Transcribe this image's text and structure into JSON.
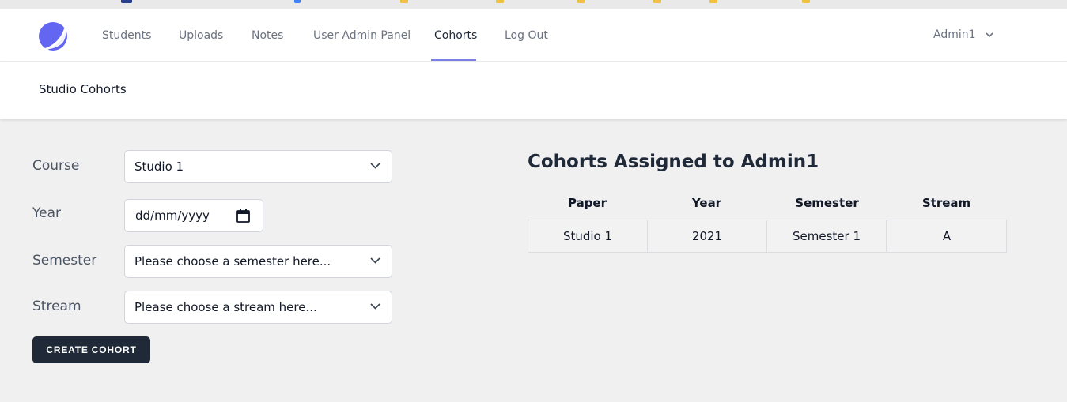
{
  "nav": {
    "links": [
      {
        "label": "Students"
      },
      {
        "label": "Uploads"
      },
      {
        "label": "Notes"
      },
      {
        "label": "User Admin Panel"
      },
      {
        "label": "Cohorts",
        "active": true
      },
      {
        "label": "Log Out"
      }
    ],
    "user": "Admin1",
    "logo_icon": "half-moon-logo-icon"
  },
  "header": {
    "title": "Studio Cohorts"
  },
  "form": {
    "course_label": "Course",
    "course_value": "Studio 1",
    "year_label": "Year",
    "year_placeholder": "dd/mm/yyyy",
    "semester_label": "Semester",
    "semester_value": "Please choose a semester here...",
    "stream_label": "Stream",
    "stream_value": "Please choose a stream here...",
    "create_button": "CREATE COHORT"
  },
  "table": {
    "title": "Cohorts Assigned to Admin1",
    "headers": [
      "Paper",
      "Year",
      "Semester",
      "Stream"
    ],
    "rows": [
      [
        "Studio 1",
        "2021",
        "Semester 1",
        "A"
      ]
    ]
  },
  "colors": {
    "accent": "#7c7fe6",
    "button_bg": "#1f2937",
    "page_bg": "#f0f0f1"
  }
}
